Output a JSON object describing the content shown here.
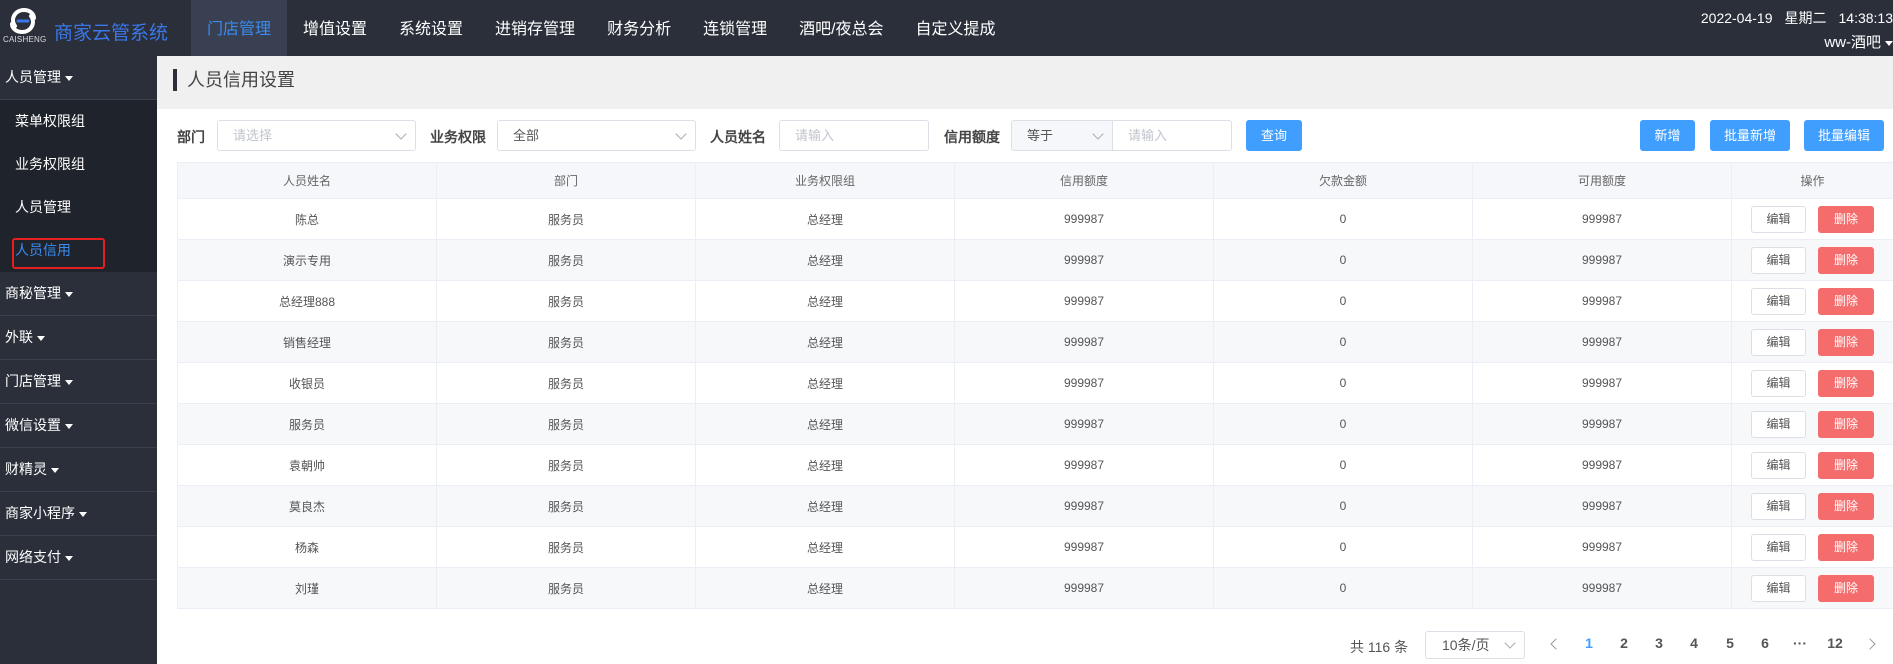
{
  "header": {
    "logo_text": "CAISHENG",
    "brand": "商家云管系统",
    "nav": [
      "门店管理",
      "增值设置",
      "系统设置",
      "进销存管理",
      "财务分析",
      "连锁管理",
      "酒吧/夜总会",
      "自定义提成"
    ],
    "date": "2022-04-19",
    "weekday": "星期二",
    "time": "14:38:13",
    "user": "ww-酒吧"
  },
  "sidebar": {
    "groups": [
      "人员管理",
      "商秘管理",
      "外联",
      "门店管理",
      "微信设置",
      "财精灵",
      "商家小程序",
      "网络支付"
    ],
    "sub_items": [
      "菜单权限组",
      "业务权限组",
      "人员管理",
      "人员信用"
    ]
  },
  "page": {
    "title": "人员信用设置"
  },
  "filters": {
    "dept_label": "部门",
    "dept_placeholder": "请选择",
    "perm_label": "业务权限",
    "perm_value": "全部",
    "name_label": "人员姓名",
    "name_placeholder": "请输入",
    "credit_label": "信用额度",
    "credit_op": "等于",
    "credit_placeholder": "请输入",
    "query_button": "查询",
    "add_button": "新增",
    "batch_add_button": "批量新增",
    "batch_edit_button": "批量编辑"
  },
  "table": {
    "headers": [
      "人员姓名",
      "部门",
      "业务权限组",
      "信用额度",
      "欠款金额",
      "可用额度",
      "操作"
    ],
    "edit_label": "编辑",
    "delete_label": "删除",
    "rows": [
      [
        "陈总",
        "服务员",
        "总经理",
        "999987",
        "0",
        "999987"
      ],
      [
        "演示专用",
        "服务员",
        "总经理",
        "999987",
        "0",
        "999987"
      ],
      [
        "总经理888",
        "服务员",
        "总经理",
        "999987",
        "0",
        "999987"
      ],
      [
        "销售经理",
        "服务员",
        "总经理",
        "999987",
        "0",
        "999987"
      ],
      [
        "收银员",
        "服务员",
        "总经理",
        "999987",
        "0",
        "999987"
      ],
      [
        "服务员",
        "服务员",
        "总经理",
        "999987",
        "0",
        "999987"
      ],
      [
        "袁朝帅",
        "服务员",
        "总经理",
        "999987",
        "0",
        "999987"
      ],
      [
        "莫良杰",
        "服务员",
        "总经理",
        "999987",
        "0",
        "999987"
      ],
      [
        "杨森",
        "服务员",
        "总经理",
        "999987",
        "0",
        "999987"
      ],
      [
        "刘瑾",
        "服务员",
        "总经理",
        "999987",
        "0",
        "999987"
      ]
    ]
  },
  "pagination": {
    "total": "共 116 条",
    "page_size": "10条/页",
    "pages": [
      "1",
      "2",
      "3",
      "4",
      "5",
      "6",
      "···",
      "12"
    ],
    "current": "1"
  },
  "colors": {
    "sidebar_bg": "#2a2f3a",
    "accent": "#409eff",
    "danger": "#f56c6c",
    "brand": "#3b77e8"
  }
}
